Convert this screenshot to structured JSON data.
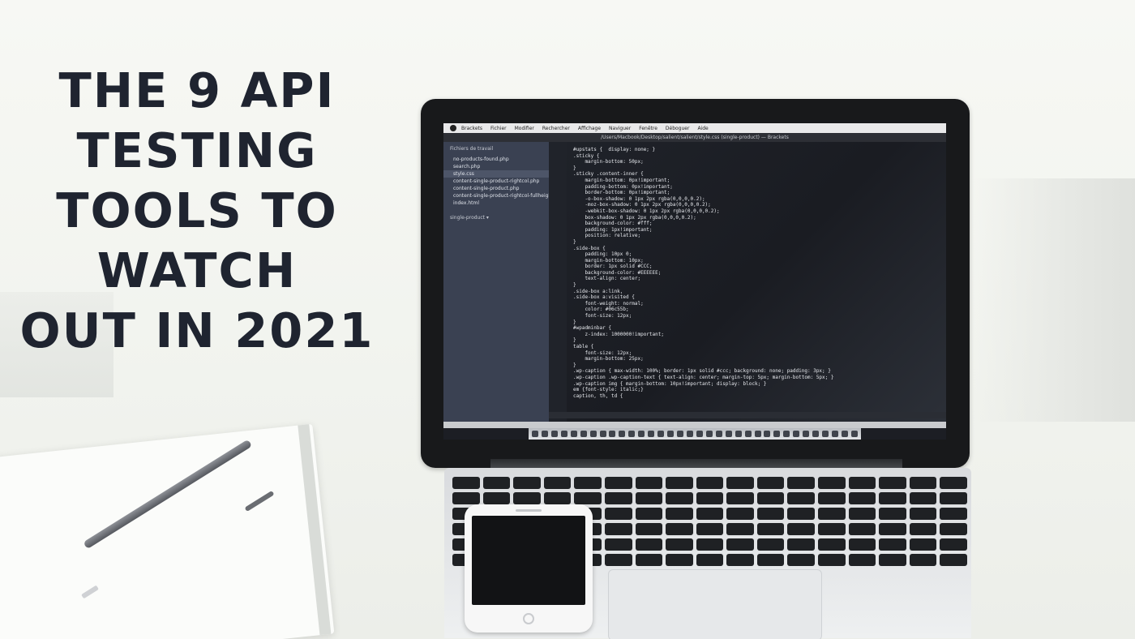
{
  "headline": {
    "lines": [
      "THE 9 API",
      "TESTING",
      "TOOLS TO",
      "WATCH",
      "OUT IN 2021"
    ]
  },
  "screen": {
    "menubar": [
      "Brackets",
      "Fichier",
      "Modifier",
      "Rechercher",
      "Affichage",
      "Naviguer",
      "Fenêtre",
      "Déboguer",
      "Aide"
    ],
    "title": "/Users/Macbook/Desktop/salient/salient/style.css (single-product) — Brackets",
    "sidebar_header": "Fichiers de travail",
    "files": [
      "no-products-found.php",
      "search.php",
      "style.css",
      "content-single-product-rightcol.php",
      "content-single-product.php",
      "content-single-product-rightcol-fullheight.php",
      "index.html"
    ],
    "project": "single-product ▾",
    "code": [
      "#upstats {  display: none; }",
      "",
      ".sticky {",
      "    margin-bottom: 50px;",
      "}",
      "",
      ".sticky .content-inner {",
      "    margin-bottom: 0px!important;",
      "    padding-bottom: 0px!important;",
      "    border-bottom: 0px!important;",
      "    -o-box-shadow: 0 1px 2px rgba(0,0,0,0.2);",
      "    -moz-box-shadow: 0 1px 2px rgba(0,0,0,0.2);",
      "    -webkit-box-shadow: 0 1px 2px rgba(0,0,0,0.2);",
      "    box-shadow: 0 1px 2px rgba(0,0,0,0.2);",
      "    background-color: #fff;",
      "    padding: 1px!important;",
      "    position: relative;",
      "}",
      "",
      ".side-box {",
      "    padding: 10px 0;",
      "    margin-bottom: 10px;",
      "    border: 1px solid #CCC;",
      "    background-color: #EEEEEE;",
      "    text-align: center;",
      "}",
      "",
      ".side-box a:link,",
      ".side-box a:visited {",
      "    font-weight: normal;",
      "    color: #06c55b;",
      "    font-size: 12px;",
      "}",
      "",
      "#wpadminbar {",
      "    z-index: 1000000!important;",
      "}",
      "",
      "table {",
      "    font-size: 12px;",
      "    margin-bottom: 25px;",
      "}",
      "",
      ".wp-caption { max-width: 100%; border: 1px solid #ccc; background: none; padding: 3px; }",
      ".wp-caption .wp-caption-text { text-align: center; margin-top: 5px; margin-bottom: 5px; }",
      ".wp-caption img { margin-bottom: 10px!important; display: block; }",
      "",
      "em {font-style: italic;}",
      "",
      "caption, th, td {"
    ]
  }
}
